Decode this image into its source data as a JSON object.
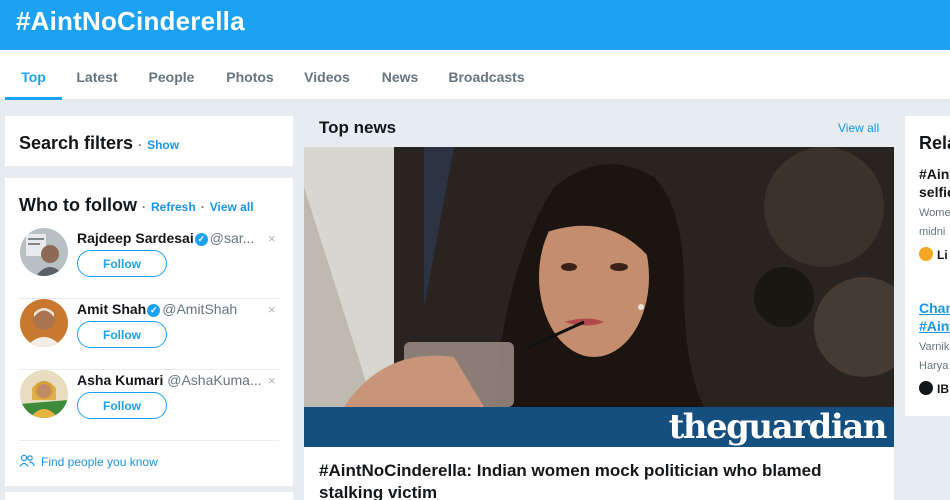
{
  "header": {
    "title": "#AintNoCinderella"
  },
  "tabs": [
    {
      "label": "Top"
    },
    {
      "label": "Latest"
    },
    {
      "label": "People"
    },
    {
      "label": "Photos"
    },
    {
      "label": "Videos"
    },
    {
      "label": "News"
    },
    {
      "label": "Broadcasts"
    }
  ],
  "search_filters": {
    "title": "Search filters",
    "separator": "·",
    "show_label": "Show"
  },
  "who_to_follow": {
    "title": "Who to follow",
    "separator": "·",
    "refresh_label": "Refresh",
    "view_all_label": "View all",
    "users": [
      {
        "name": "Rajdeep Sardesai",
        "verified": true,
        "handle": "@sar...",
        "follow_label": "Follow",
        "dismiss": "×"
      },
      {
        "name": "Amit Shah",
        "verified": true,
        "handle": "@AmitShah",
        "follow_label": "Follow",
        "dismiss": "×"
      },
      {
        "name": "Asha Kumari",
        "verified": false,
        "handle": "@AshaKuma...",
        "follow_label": "Follow",
        "dismiss": "×"
      }
    ],
    "find_people_label": "Find people you know"
  },
  "top_news": {
    "title": "Top news",
    "view_all_label": "View all",
    "image_watermark": "theguardian",
    "headline": "#AintNoCinderella: Indian women mock politician who blamed stalking victim"
  },
  "related": {
    "title": "Rela",
    "items": [
      {
        "title_line1": "#Aint",
        "title_line2": "selfie",
        "text_line1": "Wome",
        "text_line2": "midni",
        "source": "Li",
        "source_color": "#f5a623"
      },
      {
        "title_line1": "Chan",
        "title_line2": "#Aint",
        "text_line1": "Varnik",
        "text_line2": "Harya",
        "source": "IB",
        "source_color": "#14171a"
      }
    ]
  },
  "colors": {
    "accent": "#1da1f2",
    "link": "#1b95e0",
    "guardian_band": "#154f7f"
  }
}
